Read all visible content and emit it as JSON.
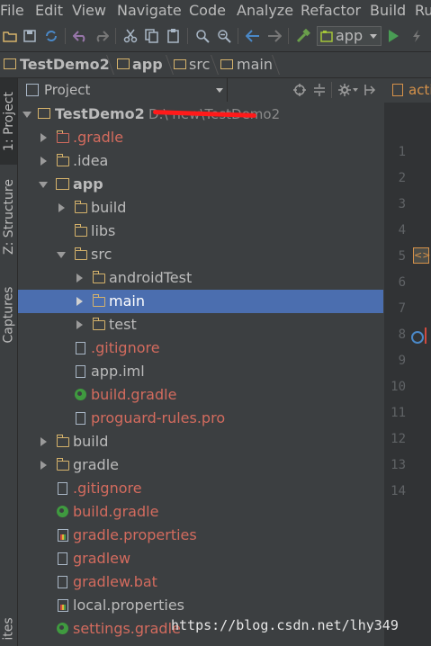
{
  "menu": [
    "File",
    "Edit",
    "View",
    "Navigate",
    "Code",
    "Analyze",
    "Refactor",
    "Build",
    "Ru"
  ],
  "toolbar": {
    "run_config": "app",
    "colors": {
      "green": "#499c54",
      "blue": "#4a88c7",
      "purple": "#9876aa"
    }
  },
  "breadcrumb": [
    "TestDemo2",
    "app",
    "src",
    "main"
  ],
  "left_strip": {
    "tabs": [
      "1: Project",
      "Z: Structure",
      "Captures"
    ],
    "bottom_tab": "ites"
  },
  "project_panel": {
    "title": "Project",
    "dropdown_icon": "chevron-down-icon",
    "actions": [
      "target-icon",
      "collapse-icon",
      "gear-icon",
      "pin-icon"
    ]
  },
  "editor": {
    "tab_label": "acti",
    "line_numbers": [
      "1",
      "2",
      "3",
      "4",
      "5",
      "6",
      "7",
      "8",
      "9",
      "10",
      "11",
      "12",
      "13",
      "14"
    ]
  },
  "tree": {
    "root_name": "TestDemo2",
    "root_path": "D:\\       new\\TestDemo2",
    "items": [
      {
        "label": ".gradle",
        "color": "red"
      },
      {
        "label": ".idea",
        "color": "default"
      },
      {
        "label": "app",
        "color": "bold"
      },
      {
        "label": "build",
        "color": "default"
      },
      {
        "label": "libs",
        "color": "default"
      },
      {
        "label": "src",
        "color": "default"
      },
      {
        "label": "androidTest",
        "color": "default"
      },
      {
        "label": "main",
        "color": "default"
      },
      {
        "label": "test",
        "color": "default"
      },
      {
        "label": ".gitignore",
        "color": "red"
      },
      {
        "label": "app.iml",
        "color": "default"
      },
      {
        "label": "build.gradle",
        "color": "red"
      },
      {
        "label": "proguard-rules.pro",
        "color": "red"
      },
      {
        "label": "build",
        "color": "default"
      },
      {
        "label": "gradle",
        "color": "default"
      },
      {
        "label": ".gitignore",
        "color": "red"
      },
      {
        "label": "build.gradle",
        "color": "red"
      },
      {
        "label": "gradle.properties",
        "color": "red"
      },
      {
        "label": "gradlew",
        "color": "red"
      },
      {
        "label": "gradlew.bat",
        "color": "red"
      },
      {
        "label": "local.properties",
        "color": "default"
      },
      {
        "label": "settings.gradle",
        "color": "red"
      }
    ]
  },
  "watermark": "https://blog.csdn.net/lhy349"
}
